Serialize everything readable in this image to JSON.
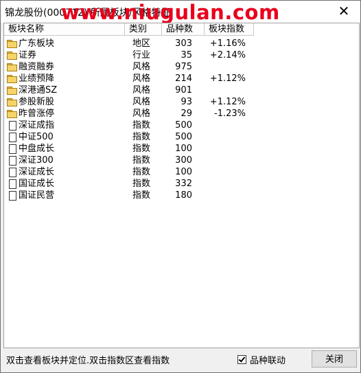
{
  "window": {
    "title": "锦龙股份(000712)  所属板块/风格特征",
    "watermark": "www.niugulan.com",
    "close_icon": "close-icon"
  },
  "table": {
    "columns": [
      "板块名称",
      "类别",
      "品种数",
      "板块指数"
    ],
    "rows": [
      {
        "icon": "folder-icon",
        "name": "广东板块",
        "type": "地区",
        "count": "303",
        "index": "+1.16%"
      },
      {
        "icon": "folder-icon",
        "name": "证券",
        "type": "行业",
        "count": "35",
        "index": "+2.14%"
      },
      {
        "icon": "folder-icon",
        "name": "融资融券",
        "type": "风格",
        "count": "975",
        "index": ""
      },
      {
        "icon": "folder-icon",
        "name": "业绩预降",
        "type": "风格",
        "count": "214",
        "index": "+1.12%"
      },
      {
        "icon": "folder-icon",
        "name": "深港通SZ",
        "type": "风格",
        "count": "901",
        "index": ""
      },
      {
        "icon": "folder-icon",
        "name": "参股新股",
        "type": "风格",
        "count": "93",
        "index": "+1.12%"
      },
      {
        "icon": "folder-icon",
        "name": "昨曾涨停",
        "type": "风格",
        "count": "29",
        "index": "-1.23%"
      },
      {
        "icon": "page-icon",
        "name": "深证成指",
        "type": "指数",
        "count": "500",
        "index": ""
      },
      {
        "icon": "page-icon",
        "name": "中证500",
        "type": "指数",
        "count": "500",
        "index": ""
      },
      {
        "icon": "page-icon",
        "name": "中盘成长",
        "type": "指数",
        "count": "100",
        "index": ""
      },
      {
        "icon": "page-icon",
        "name": "深证300",
        "type": "指数",
        "count": "300",
        "index": ""
      },
      {
        "icon": "page-icon",
        "name": "深证成长",
        "type": "指数",
        "count": "100",
        "index": ""
      },
      {
        "icon": "page-icon",
        "name": "国证成长",
        "type": "指数",
        "count": "332",
        "index": ""
      },
      {
        "icon": "page-icon",
        "name": "国证民营",
        "type": "指数",
        "count": "180",
        "index": ""
      }
    ]
  },
  "footer": {
    "status_text": "双击查看板块并定位.双击指数区查看指数",
    "checkbox_label": "品种联动",
    "checkbox_checked": true,
    "close_button": "关闭"
  }
}
